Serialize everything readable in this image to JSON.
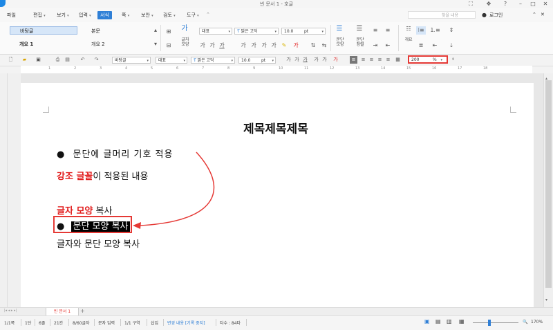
{
  "window": {
    "title": "빈 문서 1 - 호글"
  },
  "menubar": {
    "items": [
      "파일",
      "편집",
      "보기",
      "입력",
      "서식",
      "쪽",
      "보안",
      "검토",
      "도구"
    ],
    "active": "서식",
    "search_placeholder": "찾을 내용",
    "login": "로그인"
  },
  "ribbon": {
    "styles": [
      "바탕글",
      "본문",
      "개요 1",
      "개요 2"
    ],
    "char_shape_label": "글자\n모양",
    "style_combo": "대표",
    "font_combo": "맑은 고딕",
    "size_combo": "10.0",
    "size_unit": "pt",
    "para_shape_label": "문단\n모양",
    "para_align_label": "문단\n정렬",
    "outline_label": "개요"
  },
  "toolbar2": {
    "style_combo": "바탕글",
    "lang_combo": "대표",
    "font_combo": "맑은 고딕",
    "size_combo": "10.0",
    "size_unit": "pt",
    "zoom_value": "200",
    "zoom_unit": "%"
  },
  "ruler": {
    "numbers": [
      "1",
      "2",
      "3",
      "4",
      "5",
      "6",
      "7",
      "8",
      "9",
      "10",
      "11",
      "12",
      "13",
      "14",
      "15",
      "16",
      "17",
      "18"
    ]
  },
  "document": {
    "title": "제목제목제목",
    "bullet_line": "문단에 글머리 기호 적용",
    "emphasis_red": "강조 글꼴",
    "emphasis_rest": "이 적용된 내용",
    "copy_char_red": "글자 모양",
    "copy_char_rest": " 복사",
    "copy_para": "문단 모양 복사",
    "copy_both": "글자와 문단 모양 복사",
    "bullet_glyph": "●"
  },
  "tabbar": {
    "tab": "빈 문서 1"
  },
  "status": {
    "page": "1/1쪽",
    "section": "1단",
    "line": "6줄",
    "col": "21칸",
    "chars": "8/60글자",
    "mode": "문자 입력",
    "area": "1/1 구역",
    "insert": "삽입",
    "track": "변경 내용 [기록 중지]",
    "typing": "타수 : 84타",
    "zoom": "170%"
  },
  "colors": {
    "accent": "#2f7fd6",
    "highlight": "#e53935",
    "emphasis": "#e11a1a"
  },
  "icons": [
    "app-icon",
    "minimize-icon",
    "maximize-icon",
    "close-icon",
    "help-icon",
    "new-doc-icon",
    "open-icon",
    "save-icon",
    "print-icon",
    "undo-icon",
    "redo-icon",
    "bold-icon",
    "italic-icon",
    "underline-icon",
    "align-left-icon",
    "align-center-icon",
    "align-right-icon",
    "justify-icon",
    "zoom-icon",
    "ink-icon"
  ]
}
